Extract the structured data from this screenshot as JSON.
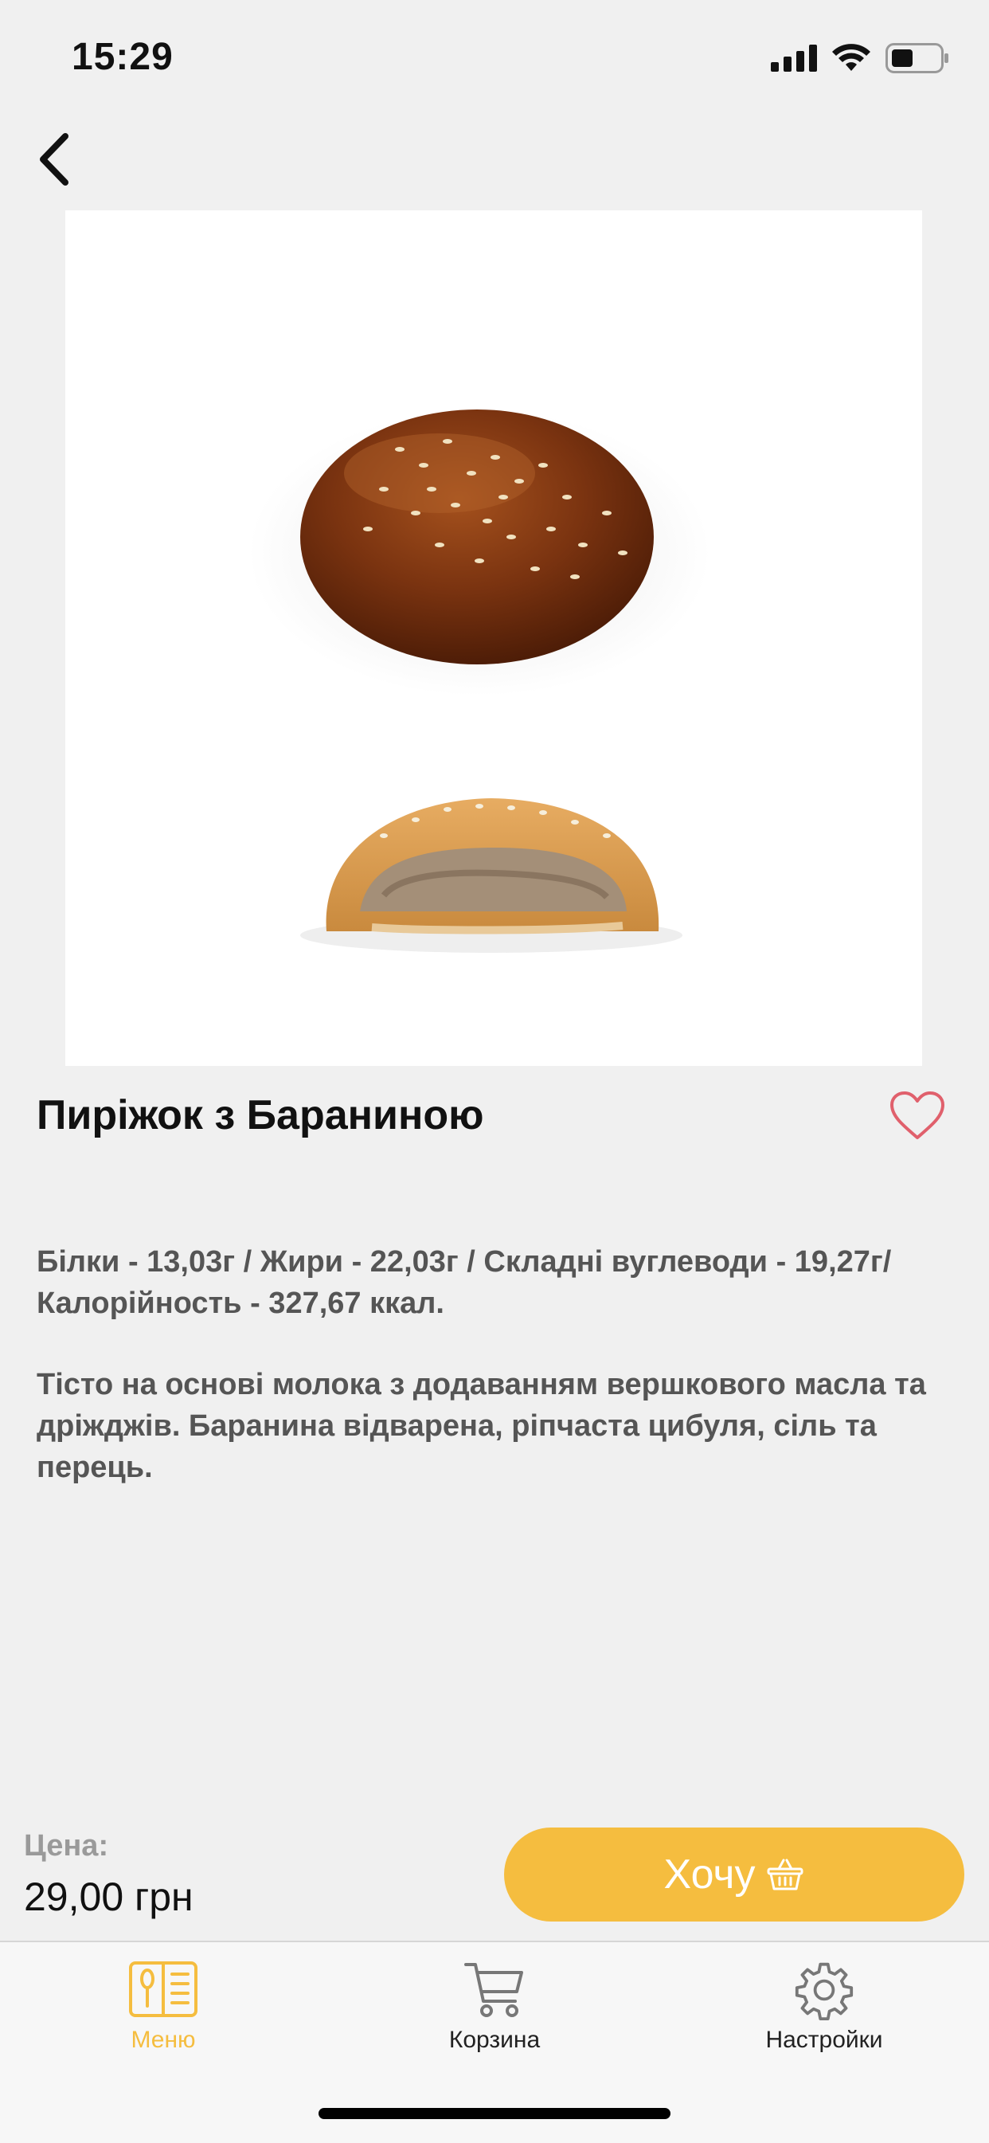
{
  "status_bar": {
    "time": "15:29"
  },
  "product": {
    "title": "Пиріжок з Бараниною",
    "nutrition": "Білки - 13,03г / Жири - 22,03г / Складні вуглеводи - 19,27г/ Калорійность - 327,67 ккал.",
    "description": "Тісто на основі молока з додаванням вершкового масла та дріжджів. Баранина відварена, ріпчаста цибуля, сіль та перець.",
    "favorite_icon": "heart-outline-icon"
  },
  "purchase": {
    "price_label": "Цена:",
    "price_value": "29,00 грн",
    "want_label": "Хочу",
    "want_icon": "basket-icon"
  },
  "tabs": [
    {
      "label": "Меню",
      "icon": "menu-book-icon",
      "active": true
    },
    {
      "label": "Корзина",
      "icon": "cart-icon",
      "active": false
    },
    {
      "label": "Настройки",
      "icon": "gear-icon",
      "active": false
    }
  ],
  "colors": {
    "accent": "#f5bd3f",
    "favorite": "#e0606c",
    "background": "#f0f0f0",
    "secondary_text": "#555555"
  }
}
